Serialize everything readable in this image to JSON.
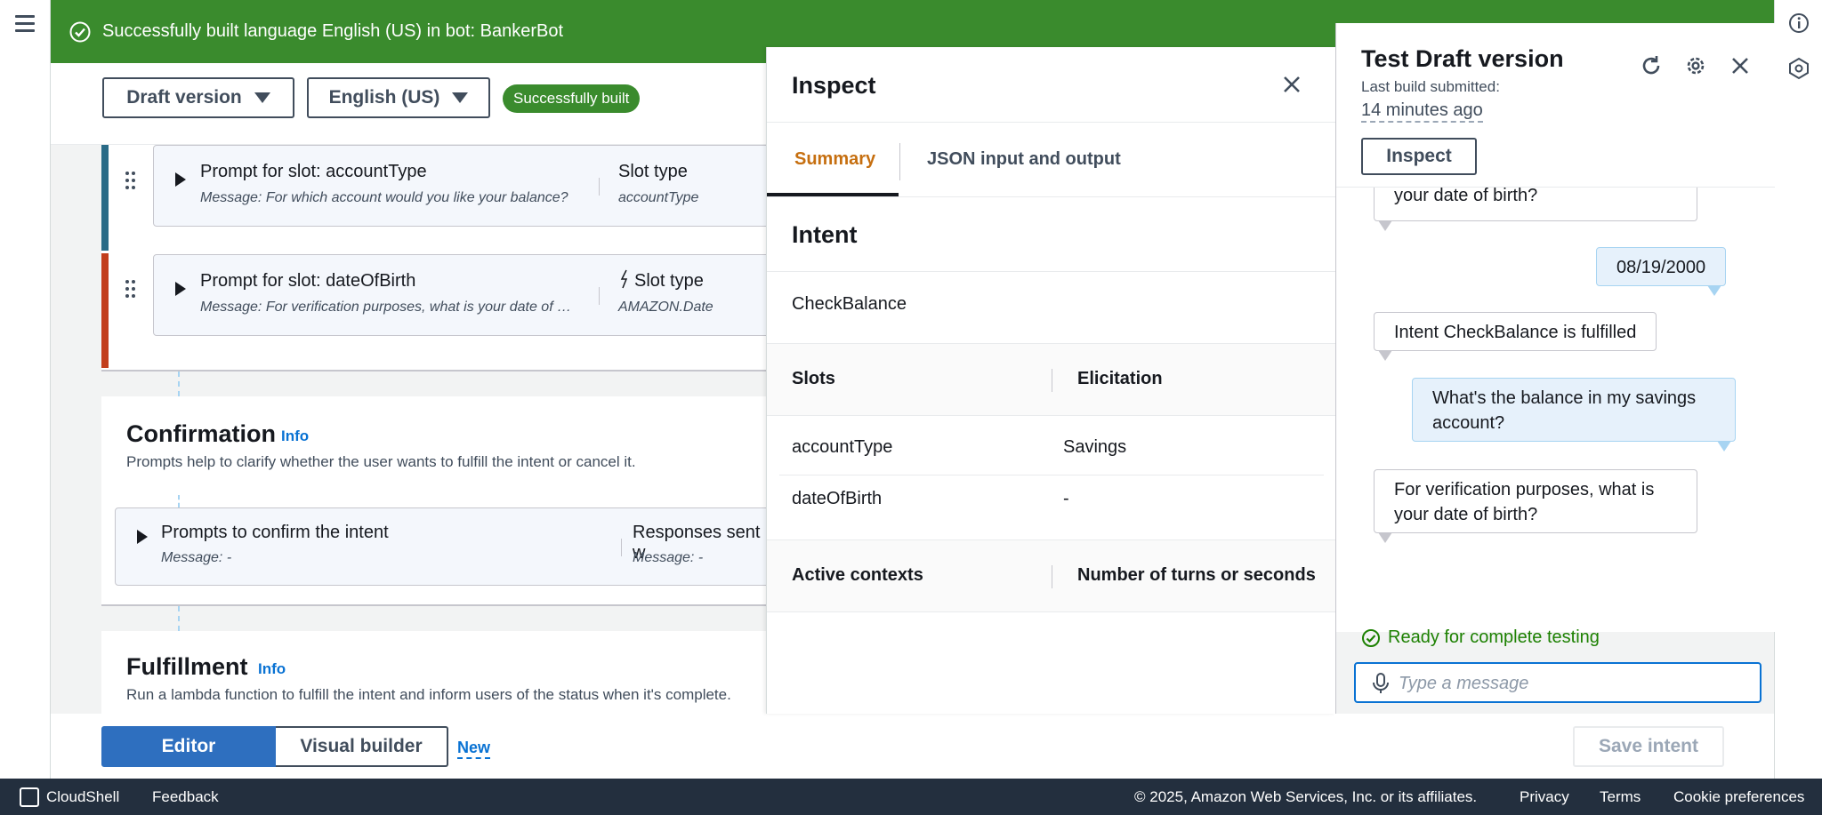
{
  "flash": {
    "message": "Successfully built language English (US) in bot: BankerBot"
  },
  "toolbar": {
    "version_label": "Draft version",
    "language_label": "English (US)",
    "status_badge": "Successfully built"
  },
  "slots": [
    {
      "title": "Prompt for slot: accountType",
      "message": "Message: For which account would you like your balance?",
      "type_label": "Slot type",
      "type_value": "accountType"
    },
    {
      "title": "Prompt for slot: dateOfBirth",
      "message": "Message: For verification purposes, what is your date of birth?",
      "type_label": "Slot type",
      "type_value": "AMAZON.Date"
    }
  ],
  "confirmation": {
    "title": "Confirmation",
    "info": "Info",
    "description": "Prompts help to clarify whether the user wants to fulfill the intent or cancel it.",
    "row_title": "Prompts to confirm the intent",
    "row_message": "Message: -",
    "responses_label": "Responses sent w",
    "responses_message": "Message: -"
  },
  "fulfillment": {
    "title": "Fulfillment",
    "info": "Info",
    "description": "Run a lambda function to fulfill the intent and inform users of the status when it's complete."
  },
  "bottombar": {
    "editor_label": "Editor",
    "visual_builder_label": "Visual builder",
    "new_label": "New",
    "save_label": "Save intent"
  },
  "inspect": {
    "title": "Inspect",
    "tabs": [
      {
        "label": "Summary"
      },
      {
        "label": "JSON input and output"
      }
    ],
    "intent_heading": "Intent",
    "intent_name": "CheckBalance",
    "slots_header": "Slots",
    "elicitation_header": "Elicitation",
    "slot_rows": [
      {
        "name": "accountType",
        "value": "Savings"
      },
      {
        "name": "dateOfBirth",
        "value": "-"
      }
    ],
    "contexts_header": "Active contexts",
    "turns_header": "Number of turns or seconds"
  },
  "test": {
    "title": "Test Draft version",
    "last_build_label": "Last build submitted:",
    "last_build_ago": "14 minutes ago",
    "inspect_button": "Inspect",
    "messages": [
      {
        "from": "bot",
        "text": "your date of birth?"
      },
      {
        "from": "user",
        "text": "08/19/2000"
      },
      {
        "from": "bot",
        "text": "Intent CheckBalance is fulfilled"
      },
      {
        "from": "user",
        "text": "What's the balance in my savings account?"
      },
      {
        "from": "bot",
        "text": "For verification purposes, what is your date of birth?"
      }
    ],
    "ready_text": "Ready for complete testing",
    "input_placeholder": "Type a message"
  },
  "footer": {
    "cloudshell": "CloudShell",
    "feedback": "Feedback",
    "copyright": "© 2025, Amazon Web Services, Inc. or its affiliates.",
    "privacy": "Privacy",
    "terms": "Terms",
    "cookies": "Cookie preferences"
  },
  "colors": {
    "success": "#3a8b2d",
    "accent_orange": "#c66f10",
    "link": "#0972d3",
    "footer_bg": "#232f3e"
  },
  "icons": [
    "menu-icon",
    "check-circle-icon",
    "info-icon",
    "lex-icon",
    "drag-handle-icon",
    "expand-icon",
    "close-icon",
    "refresh-icon",
    "gear-icon",
    "microphone-icon",
    "cloudshell-icon"
  ]
}
